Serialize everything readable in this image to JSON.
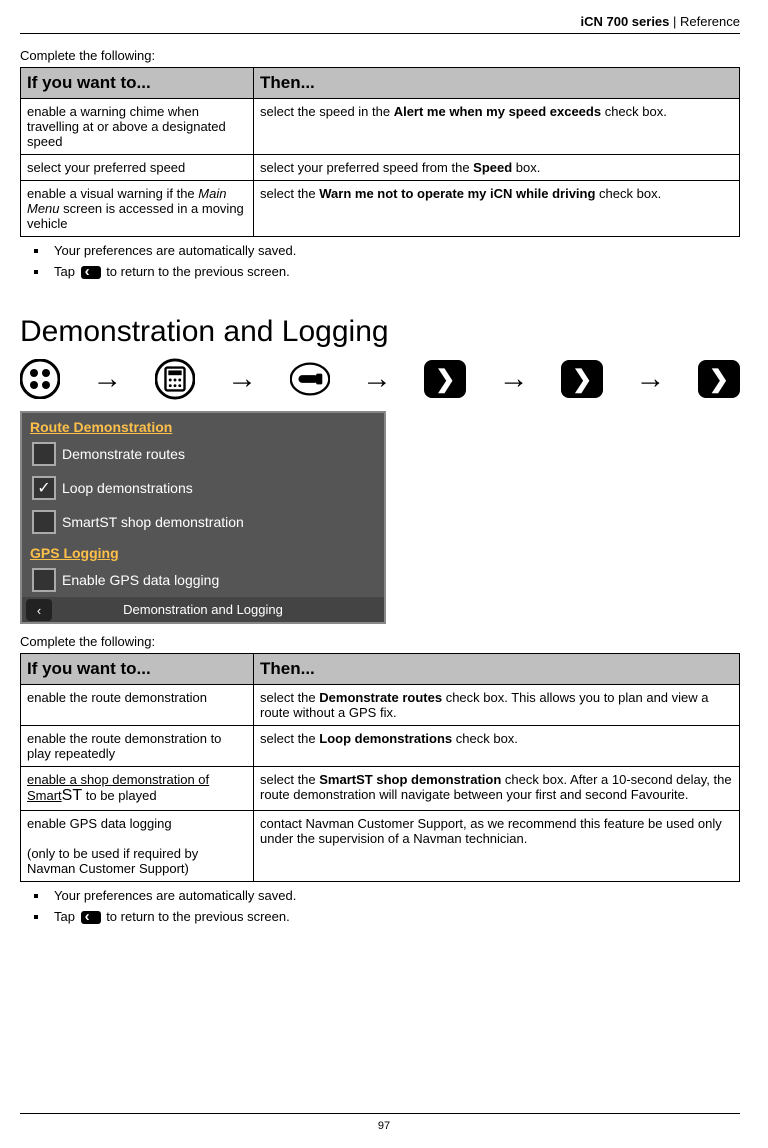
{
  "header": {
    "series": "iCN 700 series",
    "sep": "  |  ",
    "section": "Reference"
  },
  "intro1": "Complete the following:",
  "table1": {
    "h1": "If you want to...",
    "h2": "Then...",
    "rows": [
      {
        "c1": "enable a warning chime when travelling at or above a designated speed",
        "c2a": "select the speed in the ",
        "c2b": "Alert me when my speed exceeds",
        "c2c": " check box."
      },
      {
        "c1": "select your preferred speed",
        "c2a": "select your preferred speed from the ",
        "c2b": "Speed",
        "c2c": " box."
      },
      {
        "c1p": "enable a visual warning if the ",
        "c1i": "Main Menu",
        "c1s": " screen is accessed in a moving vehicle",
        "c2a": "select the ",
        "c2b": "Warn me not to operate my iCN while driving",
        "c2c": " check box."
      }
    ]
  },
  "bul1": {
    "b1": "Your preferences are automatically saved.",
    "b2a": "Tap ",
    "b2b": " to return to the previous screen."
  },
  "h1": "Demonstration and Logging",
  "screen": {
    "sec1": "Route Demonstration",
    "r1": "Demonstrate routes",
    "r2": "Loop demonstrations",
    "r3": "SmartST shop demonstration",
    "sec2": "GPS Logging",
    "r4": "Enable GPS data logging",
    "footer": "Demonstration and Logging"
  },
  "intro2": "Complete the following:",
  "table2": {
    "h1": "If you want to...",
    "h2": "Then...",
    "rows": [
      {
        "c1": "enable the route demonstration",
        "c2a": "select the ",
        "c2b": "Demonstrate routes",
        "c2c": " check box. This allows you to plan and view a route without a GPS fix."
      },
      {
        "c1": "enable the route demonstration to play repeatedly",
        "c2a": "select the ",
        "c2b": "Loop demonstrations",
        "c2c": " check box."
      },
      {
        "c1a": "enable a shop demonstration of Smart",
        "c1b": " to be played",
        "c2a": "select the ",
        "c2b": "SmartST shop demonstration",
        "c2c": " check box. After a 10-second delay, the route demonstration will navigate between your first and second Favourite."
      },
      {
        "c1a": "enable GPS data logging",
        "c1b": "(only to be used if required by Navman Customer Support)",
        "c2": "contact Navman Customer Support, as we recommend this feature be used only under the supervision of a Navman technician."
      }
    ]
  },
  "bul2": {
    "b1": "Your preferences are automatically saved.",
    "b2a": "Tap ",
    "b2b": " to return to the previous screen."
  },
  "pageNum": "97"
}
